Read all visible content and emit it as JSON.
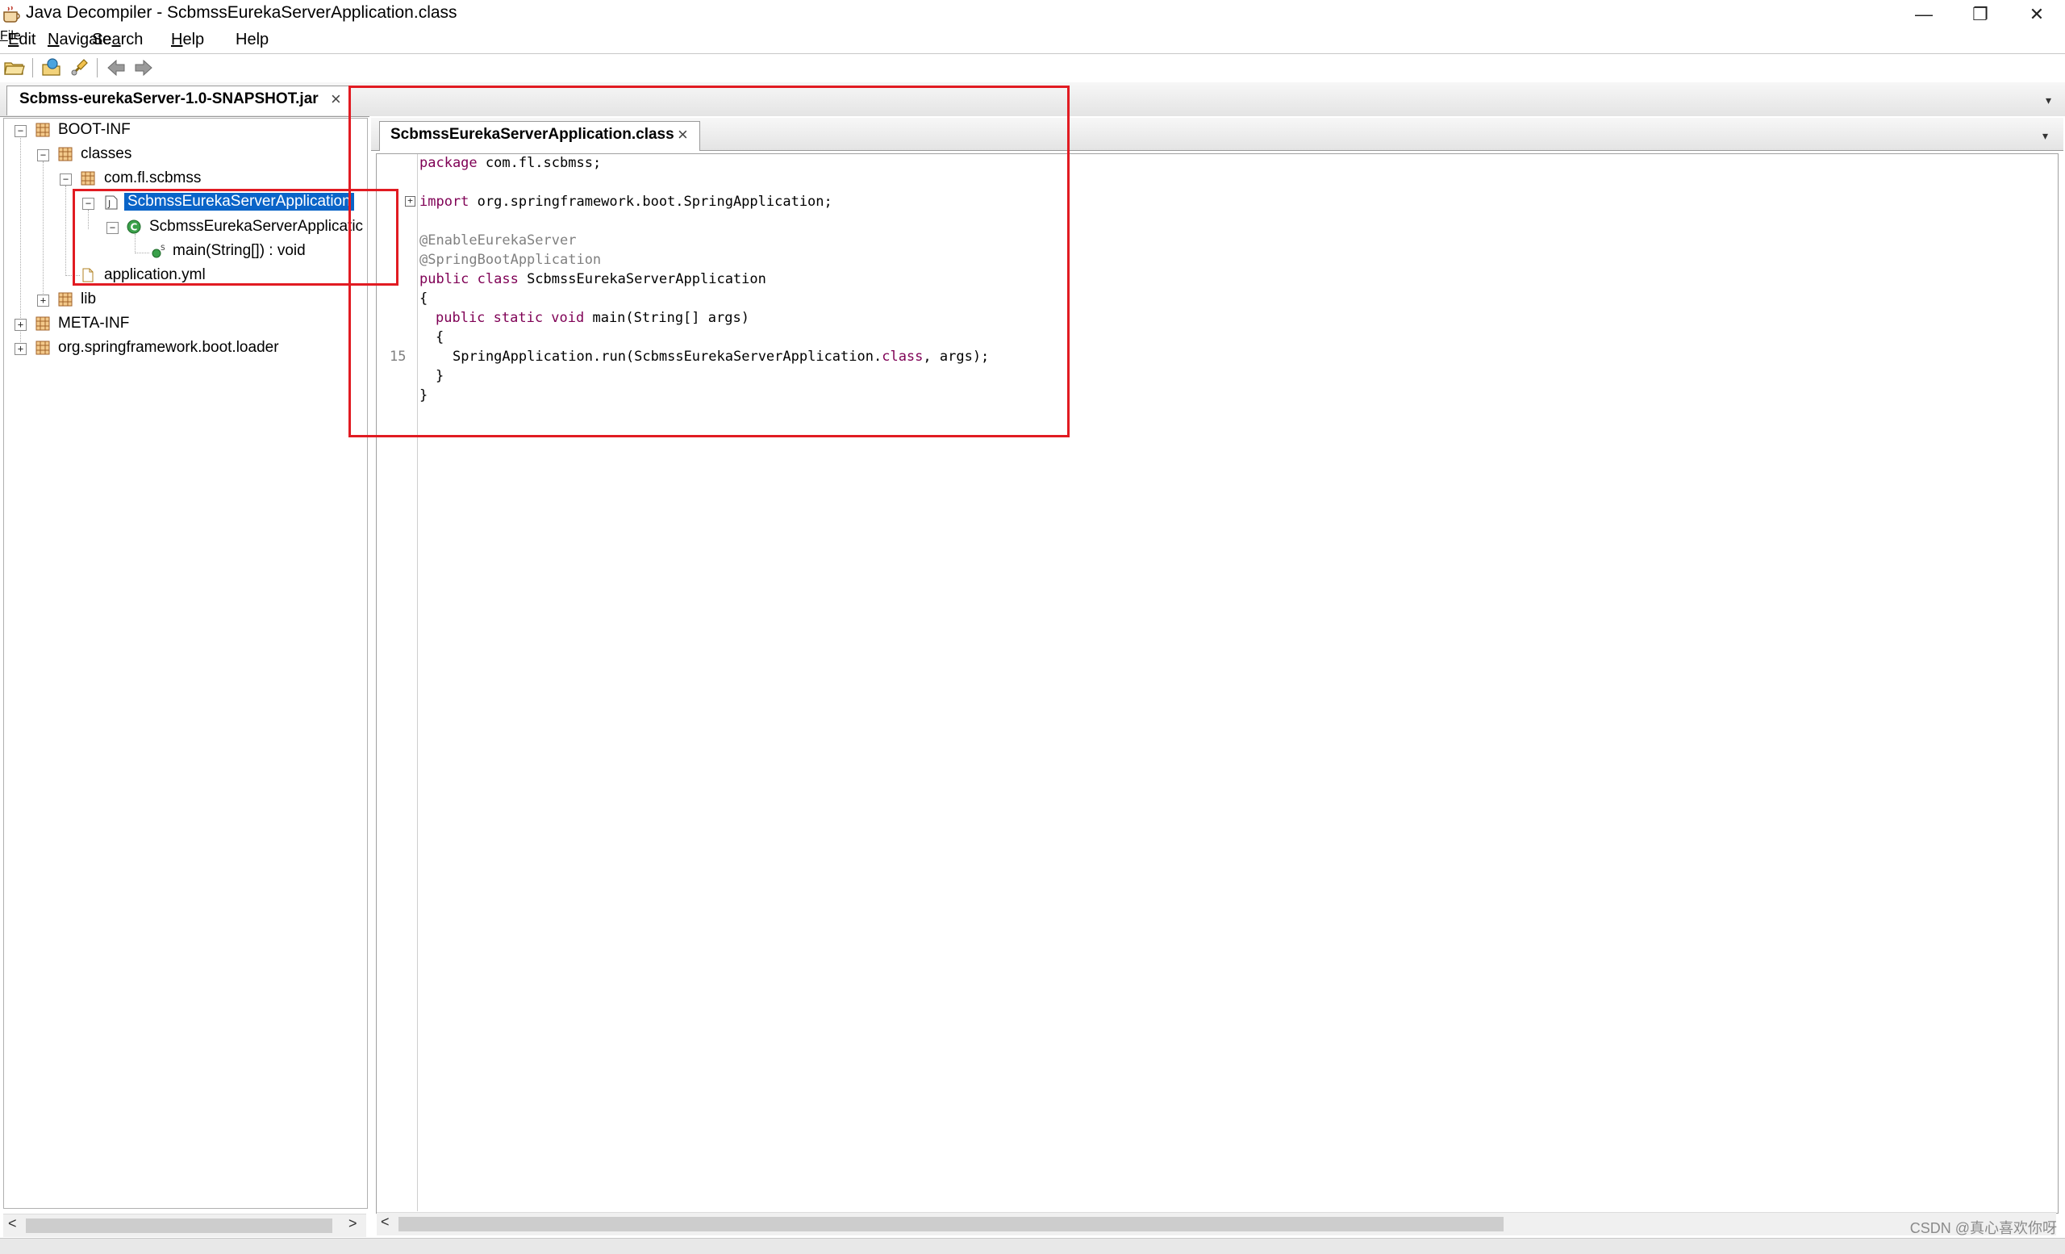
{
  "window": {
    "title": "Java Decompiler - ScbmssEurekaServerApplication.class",
    "minimize_glyph": "—",
    "restore_glyph": "❐",
    "close_glyph": "✕"
  },
  "menu": {
    "items": [
      {
        "label": "File",
        "mnemonic": "F"
      },
      {
        "label": "Edit",
        "mnemonic": "E"
      },
      {
        "label": "Navigate",
        "mnemonic": "N"
      },
      {
        "label": "Search",
        "mnemonic": "a"
      },
      {
        "label": "Help",
        "mnemonic": "H"
      }
    ]
  },
  "toolbar": {
    "icons": [
      "open-file-icon",
      "open-type-icon",
      "search-icon",
      "back-icon",
      "forward-icon"
    ]
  },
  "left_tab": {
    "label": "Scbmss-eurekaServer-1.0-SNAPSHOT.jar",
    "close": "×"
  },
  "tree": {
    "nodes": [
      {
        "label": "BOOT-INF",
        "expander": "−"
      },
      {
        "label": "classes",
        "expander": "−"
      },
      {
        "label": "com.fl.scbmss",
        "expander": "−"
      },
      {
        "label": "ScbmssEurekaServerApplication",
        "expander": "−"
      },
      {
        "label": "ScbmssEurekaServerApplicatic",
        "expander": "−"
      },
      {
        "label": "main(String[]) : void"
      },
      {
        "label": "application.yml"
      },
      {
        "label": "lib",
        "expander": "+"
      },
      {
        "label": "META-INF",
        "expander": "+"
      },
      {
        "label": "org.springframework.boot.loader",
        "expander": "+"
      }
    ],
    "static_marker": "S",
    "class_marker": "C",
    "java_marker": "J"
  },
  "right_tab": {
    "label": "ScbmssEurekaServerApplication.class",
    "close": "×"
  },
  "code": {
    "fold_marker": "+",
    "line_number": "15",
    "lines": [
      {
        "kw": "package",
        "rest": " com.fl.scbmss;"
      },
      {
        "kw": "import",
        "rest": " org.springframework.boot.SpringApplication;"
      },
      {
        "ann": "@EnableEurekaServer"
      },
      {
        "ann": "@SpringBootApplication"
      },
      {
        "kw": "public class",
        "rest": " ScbmssEurekaServerApplication"
      },
      {
        "plain": "{"
      },
      {
        "kw": "public static void",
        "rest": " main(String[] args)"
      },
      {
        "plain": "{"
      },
      {
        "pre": "SpringApplication.run(ScbmssEurekaServerApplication.",
        "kw": "class",
        "rest": ", args);"
      },
      {
        "plain": "}"
      },
      {
        "plain": "}"
      }
    ]
  },
  "scroll": {
    "left_arrow": "<",
    "right_arrow": ">"
  },
  "dropdown_glyph": "▾",
  "watermark": "CSDN @真心喜欢你呀"
}
